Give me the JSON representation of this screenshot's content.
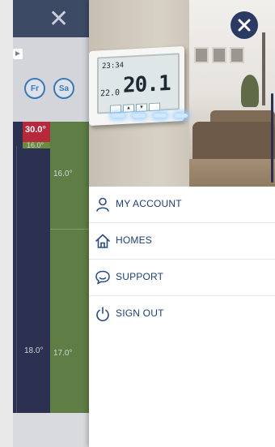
{
  "background_app": {
    "day_chips": [
      "Fr",
      "Sa"
    ],
    "temps": {
      "top_red": "30.0°",
      "top_green": "16.0°",
      "mid_green": "16.0°",
      "bottom_navy": "18.0°",
      "bottom_green": "17.0°"
    }
  },
  "thermostat_display": {
    "time": "23:34",
    "set_temp": "22.0",
    "current_temp": "20.1"
  },
  "menu": {
    "items": [
      {
        "label": "MY ACCOUNT",
        "icon": "user-icon"
      },
      {
        "label": "HOMES",
        "icon": "home-icon"
      },
      {
        "label": "SUPPORT",
        "icon": "chat-support-icon"
      },
      {
        "label": "SIGN OUT",
        "icon": "power-icon"
      }
    ]
  },
  "colors": {
    "accent_navy": "#2b3a64",
    "menu_text": "#1f3f73",
    "schedule_red": "#b8283c",
    "schedule_green": "#5e7e45"
  }
}
